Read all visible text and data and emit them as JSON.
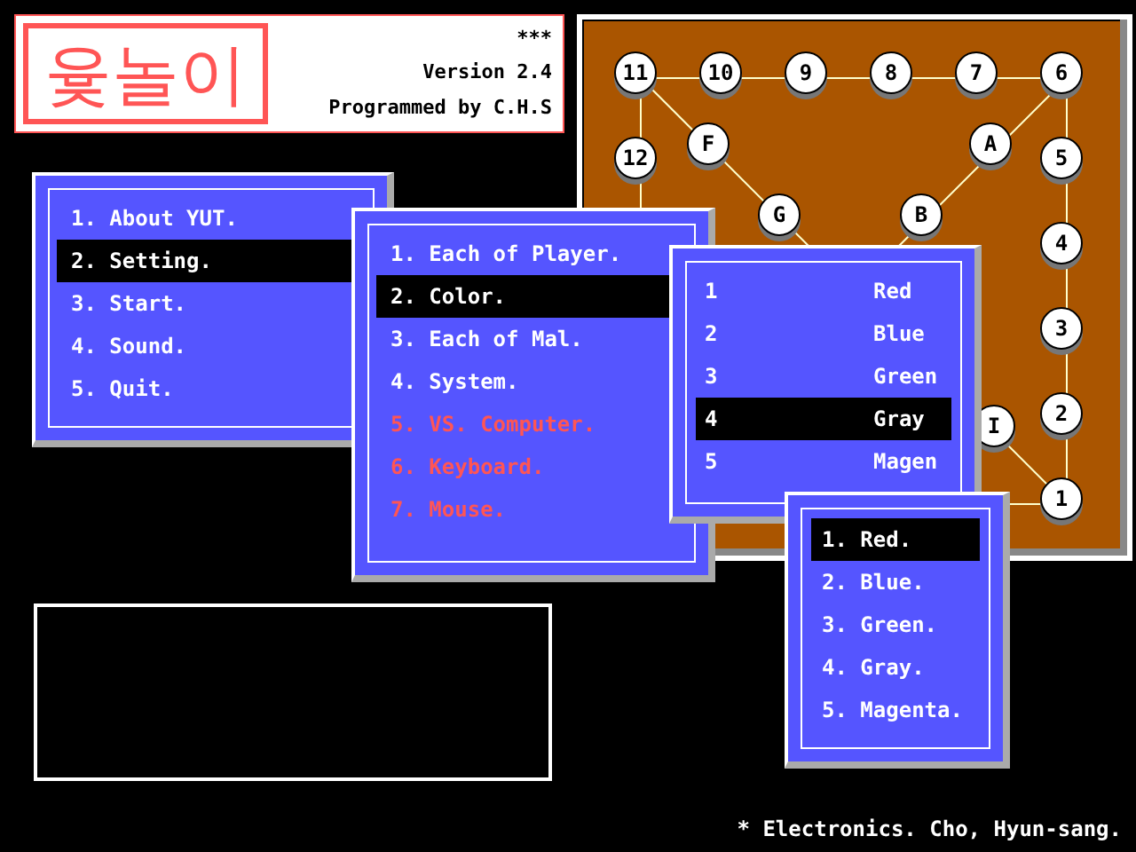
{
  "logo": {
    "title": "윷놀이",
    "mark": "***",
    "version": "Version 2.4",
    "credit": "Programmed by C.H.S"
  },
  "board": {
    "stations": [
      {
        "label": "11"
      },
      {
        "label": "10"
      },
      {
        "label": "9"
      },
      {
        "label": "8"
      },
      {
        "label": "7"
      },
      {
        "label": "6"
      },
      {
        "label": "12"
      },
      {
        "label": "5"
      },
      {
        "label": "4"
      },
      {
        "label": "3"
      },
      {
        "label": "2"
      },
      {
        "label": "1"
      },
      {
        "label": "F"
      },
      {
        "label": "A"
      },
      {
        "label": "G"
      },
      {
        "label": "B"
      },
      {
        "label": "I"
      }
    ]
  },
  "main_menu": {
    "items": [
      {
        "label": "1. About YUT.",
        "selected": false
      },
      {
        "label": "2. Setting.",
        "selected": true
      },
      {
        "label": "3. Start.",
        "selected": false
      },
      {
        "label": "4. Sound.",
        "selected": false
      },
      {
        "label": "5. Quit.",
        "selected": false
      }
    ]
  },
  "setting_menu": {
    "items": [
      {
        "label": "1. Each of Player.",
        "selected": false,
        "disabled": false
      },
      {
        "label": "2. Color.",
        "selected": true,
        "disabled": false
      },
      {
        "label": "3. Each of Mal.",
        "selected": false,
        "disabled": false
      },
      {
        "label": "4. System.",
        "selected": false,
        "disabled": false
      },
      {
        "label": "5. VS. Computer.",
        "selected": false,
        "disabled": true
      },
      {
        "label": "6. Keyboard.",
        "selected": false,
        "disabled": true
      },
      {
        "label": "7. Mouse.",
        "selected": false,
        "disabled": true
      }
    ]
  },
  "color_menu": {
    "items": [
      {
        "number": "1",
        "name": "Red",
        "selected": false
      },
      {
        "number": "2",
        "name": "Blue",
        "selected": false
      },
      {
        "number": "3",
        "name": "Green",
        "selected": false
      },
      {
        "number": "4",
        "name": "Gray",
        "selected": true
      },
      {
        "number": "5",
        "name": "Magen",
        "selected": false
      }
    ]
  },
  "color_list": {
    "items": [
      {
        "label": "1. Red.",
        "selected": true
      },
      {
        "label": "2. Blue.",
        "selected": false
      },
      {
        "label": "3. Green.",
        "selected": false
      },
      {
        "label": "4. Gray.",
        "selected": false
      },
      {
        "label": "5. Magenta.",
        "selected": false
      }
    ]
  },
  "footer": "* Electronics. Cho, Hyun-sang."
}
